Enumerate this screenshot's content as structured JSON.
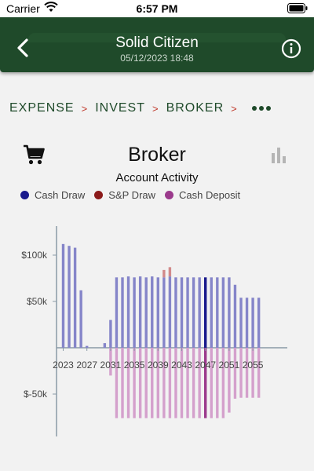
{
  "status_bar": {
    "carrier": "Carrier",
    "time": "6:57 PM"
  },
  "nav": {
    "title": "Solid Citizen",
    "subtitle": "05/12/2023 18:48",
    "back_icon": "chevron-left-icon",
    "info_icon": "info-circle-icon"
  },
  "breadcrumb": {
    "items": [
      "EXPENSE",
      "INVEST",
      "BROKER"
    ],
    "separator": ">",
    "more_icon": "ellipsis-icon"
  },
  "header": {
    "title": "Broker",
    "left_icon": "cart-icon",
    "right_icon": "bar-chart-icon"
  },
  "colors": {
    "accent": "#1f4a2a",
    "separator": "#c0392b"
  },
  "chart_data": {
    "type": "bar",
    "title": "Account Activity",
    "legend": [
      {
        "name": "Cash Draw",
        "color": "#1a1a8c"
      },
      {
        "name": "S&P Draw",
        "color": "#8b1a1a"
      },
      {
        "name": "Cash Deposit",
        "color": "#9b3a8c"
      }
    ],
    "x_tick_labels": [
      "2023",
      "2027",
      "2031",
      "2035",
      "2039",
      "2043",
      "2047",
      "2051",
      "2055"
    ],
    "y_tick_labels": [
      "$100k",
      "$50k",
      "$-50k"
    ],
    "y_ticks": [
      100000,
      50000,
      -50000
    ],
    "ylim": [
      -95000,
      130000
    ],
    "years": [
      2023,
      2024,
      2025,
      2026,
      2027,
      2028,
      2029,
      2030,
      2031,
      2032,
      2033,
      2034,
      2035,
      2036,
      2037,
      2038,
      2039,
      2040,
      2041,
      2042,
      2043,
      2044,
      2045,
      2046,
      2047,
      2048,
      2049,
      2050,
      2051,
      2052,
      2053,
      2054,
      2055,
      2056
    ],
    "series": [
      {
        "name": "Cash Draw",
        "values": [
          112000,
          110000,
          108000,
          62000,
          2000,
          0,
          0,
          5000,
          30000,
          76000,
          76000,
          77000,
          76000,
          77000,
          76000,
          77000,
          76000,
          76000,
          77000,
          76000,
          76000,
          76000,
          76000,
          76000,
          76000,
          76000,
          76000,
          76000,
          76000,
          68000,
          54000,
          54000,
          54000,
          54000
        ]
      },
      {
        "name": "S&P Draw",
        "values": [
          0,
          0,
          0,
          0,
          0,
          0,
          0,
          0,
          0,
          0,
          0,
          0,
          0,
          0,
          0,
          0,
          0,
          8000,
          10000,
          0,
          0,
          0,
          0,
          0,
          0,
          0,
          0,
          0,
          0,
          0,
          0,
          0,
          0,
          0
        ]
      },
      {
        "name": "Cash Deposit",
        "values": [
          0,
          0,
          0,
          0,
          0,
          0,
          0,
          0,
          -30000,
          -76000,
          -76000,
          -76000,
          -76000,
          -76000,
          -76000,
          -76000,
          -76000,
          -76000,
          -76000,
          -76000,
          -76000,
          -76000,
          -76000,
          -76000,
          -76000,
          -76000,
          -76000,
          -76000,
          -70000,
          -55000,
          -54000,
          -54000,
          -54000,
          -54000
        ]
      }
    ],
    "highlight_year": 2047
  }
}
